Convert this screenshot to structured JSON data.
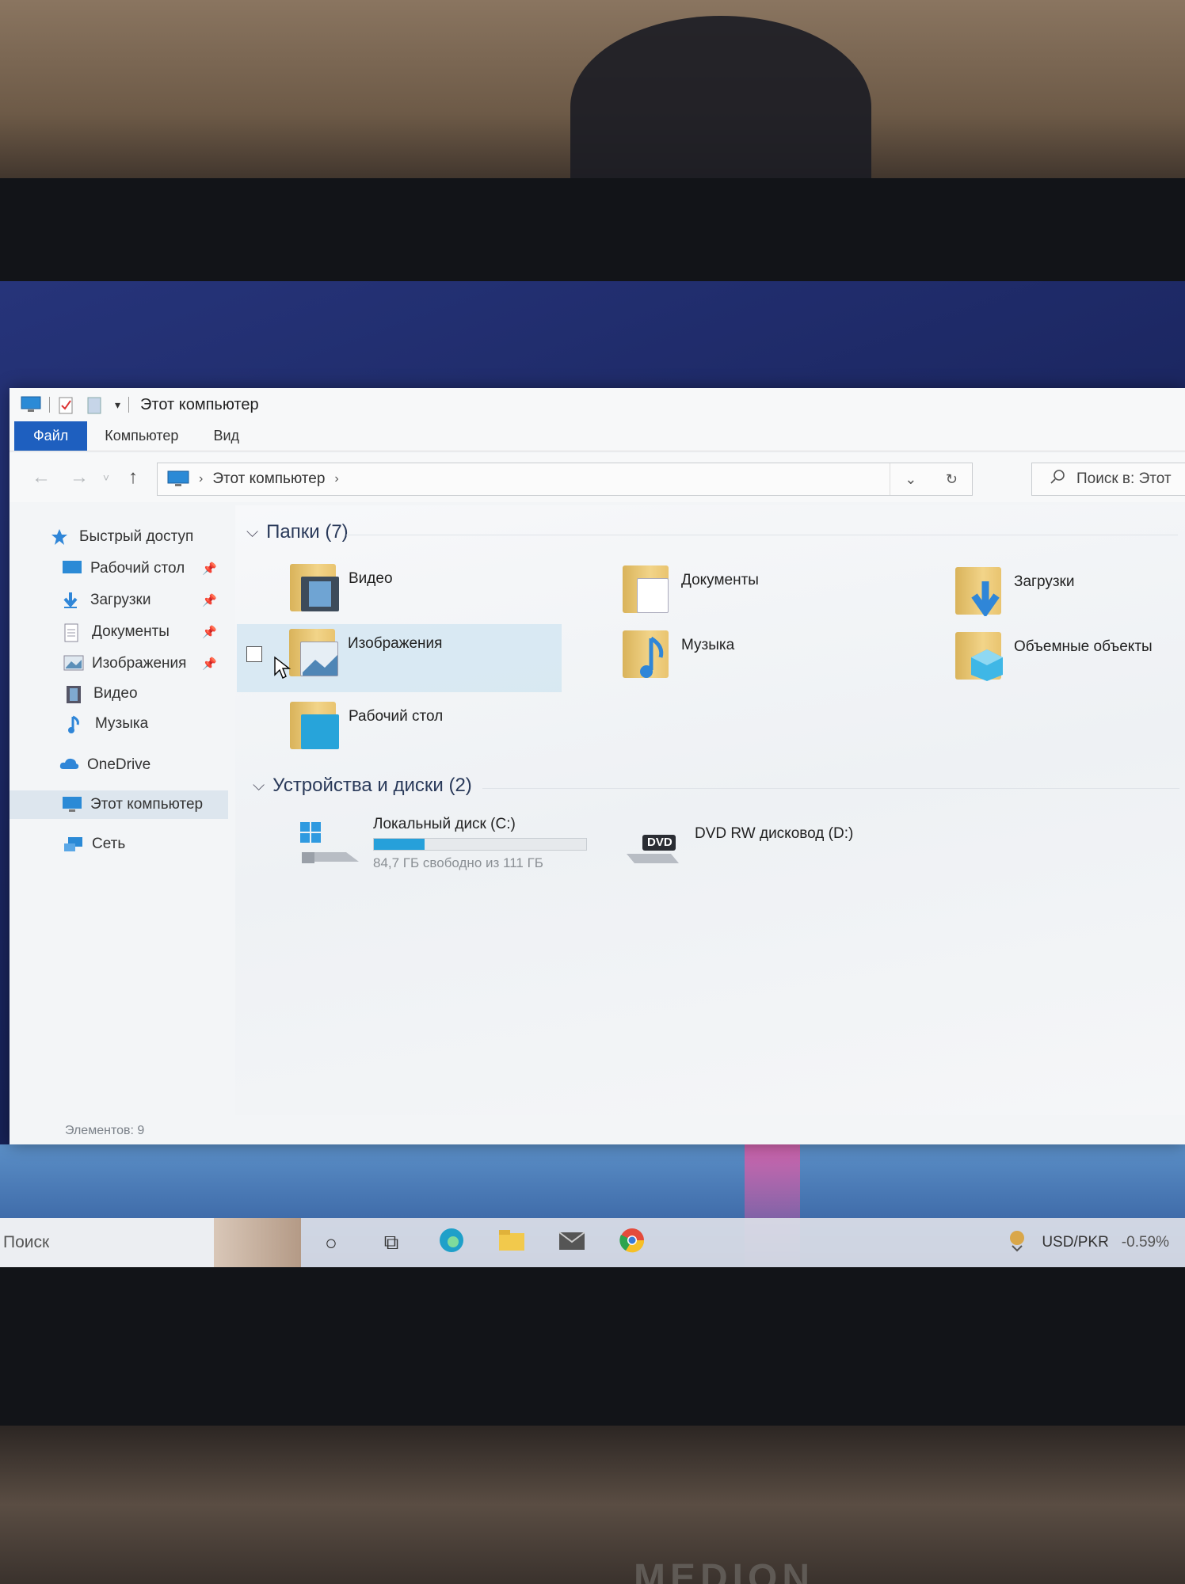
{
  "window": {
    "title": "Этот компьютер"
  },
  "ribbon": {
    "tabs": [
      "Файл",
      "Компьютер",
      "Вид"
    ]
  },
  "address": {
    "path": "Этот компьютер",
    "search_placeholder": "Поиск в: Этот"
  },
  "sidebar": {
    "items": [
      {
        "label": "Быстрый доступ",
        "icon": "star-icon"
      },
      {
        "label": "Рабочий стол",
        "icon": "desktop-icon",
        "pinned": true
      },
      {
        "label": "Загрузки",
        "icon": "download-icon",
        "pinned": true
      },
      {
        "label": "Документы",
        "icon": "document-icon",
        "pinned": true
      },
      {
        "label": "Изображения",
        "icon": "pictures-icon",
        "pinned": true
      },
      {
        "label": "Видео",
        "icon": "video-icon"
      },
      {
        "label": "Музыка",
        "icon": "music-icon"
      },
      {
        "label": "OneDrive",
        "icon": "cloud-icon"
      },
      {
        "label": "Этот компьютер",
        "icon": "computer-icon",
        "active": true
      },
      {
        "label": "Сеть",
        "icon": "network-icon"
      }
    ]
  },
  "content": {
    "folders_header": "Папки (7)",
    "folders": [
      {
        "label": "Видео",
        "icon": "video-folder-icon"
      },
      {
        "label": "Документы",
        "icon": "documents-folder-icon"
      },
      {
        "label": "Загрузки",
        "icon": "downloads-folder-icon"
      },
      {
        "label": "Изображения",
        "icon": "pictures-folder-icon",
        "selected": true
      },
      {
        "label": "Музыка",
        "icon": "music-folder-icon"
      },
      {
        "label": "Объемные объекты",
        "icon": "3d-objects-folder-icon"
      },
      {
        "label": "Рабочий стол",
        "icon": "desktop-folder-icon"
      }
    ],
    "devices_header": "Устройства и диски (2)",
    "drives": [
      {
        "name": "Локальный диск (C:)",
        "free_text": "84,7 ГБ свободно из 111 ГБ",
        "used_fraction": 0.24,
        "icon": "windows-drive-icon"
      },
      {
        "name": "DVD RW дисковод (D:)",
        "icon": "dvd-drive-icon",
        "badge": "DVD"
      }
    ]
  },
  "statusbar": {
    "items_text": "Элементов: 9"
  },
  "taskbar": {
    "search_label": "Поиск",
    "tray_currency": "USD/PKR",
    "tray_change": "-0.59%"
  },
  "colors": {
    "accent": "#1e5fbf",
    "drive_fill": "#26a0da"
  }
}
